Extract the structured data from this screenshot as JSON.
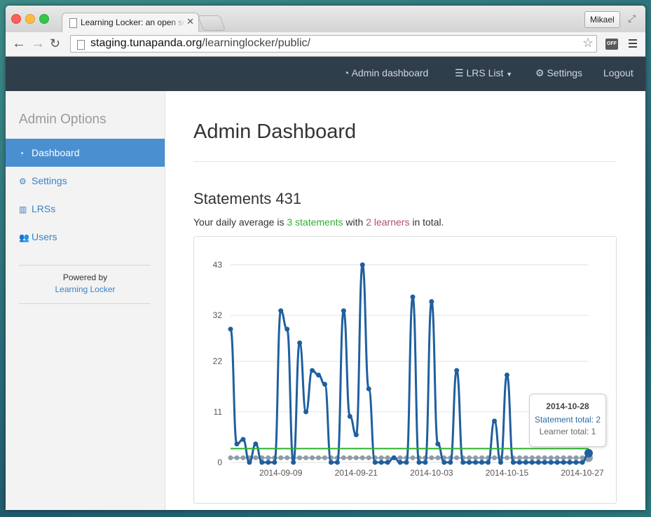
{
  "browser": {
    "tab_title": "Learning Locker: an open source LRS",
    "profile_name": "Mikael",
    "url_host": "staging.tunapanda.org",
    "url_path": "/learninglocker/public/",
    "extension_label": "OFF"
  },
  "navbar": {
    "items": [
      {
        "icon": "dashboard-icon",
        "label": "Admin dashboard"
      },
      {
        "icon": "list-icon",
        "label": "LRS List"
      },
      {
        "icon": "gear-icon",
        "label": "Settings"
      },
      {
        "icon": "",
        "label": "Logout"
      }
    ]
  },
  "sidebar": {
    "heading": "Admin Options",
    "items": [
      {
        "icon": "dashboard-icon",
        "label": "Dashboard",
        "active": true
      },
      {
        "icon": "gear-icon",
        "label": "Settings",
        "active": false
      },
      {
        "icon": "bar-chart-icon",
        "label": "LRSs",
        "active": false
      },
      {
        "icon": "users-icon",
        "label": "Users",
        "active": false
      }
    ],
    "powered_by": "Powered by",
    "powered_link": "Learning Locker"
  },
  "main": {
    "title": "Admin Dashboard",
    "statements_heading": "Statements 431",
    "daily_prefix": "Your daily average is ",
    "daily_statements": "3 statements",
    "daily_mid": " with ",
    "daily_learners": "2 learners",
    "daily_suffix": " in total."
  },
  "tooltip": {
    "date": "2014-10-28",
    "statements": "Statement total: 2",
    "learners": "Learner total: 1"
  },
  "chart_data": {
    "type": "line",
    "y_ticks": [
      0,
      11,
      22,
      32,
      43
    ],
    "ylim": [
      0,
      43
    ],
    "x_tick_labels": [
      "2014-09-09",
      "2014-09-21",
      "2014-10-03",
      "2014-10-15",
      "2014-10-27"
    ],
    "x_start": "2014-09-01",
    "average": 3,
    "grid": true,
    "series": [
      {
        "color": "#1f5f9e",
        "values": [
          29,
          4,
          5,
          0,
          4,
          0,
          0,
          0,
          33,
          29,
          0,
          26,
          11,
          20,
          19,
          17,
          0,
          0,
          33,
          10,
          6,
          43,
          16,
          0,
          0,
          0,
          1,
          0,
          0,
          36,
          0,
          0,
          35,
          4,
          0,
          0,
          20,
          0,
          0,
          0,
          0,
          0,
          9,
          0,
          19,
          0,
          0,
          0,
          0,
          0,
          0,
          0,
          0,
          0,
          0,
          0,
          0,
          2
        ]
      },
      {
        "color": "#8e9ba8",
        "values": [
          1,
          1,
          1,
          1,
          1,
          1,
          1,
          1,
          1,
          1,
          1,
          1,
          1,
          1,
          1,
          1,
          1,
          1,
          1,
          1,
          1,
          1,
          1,
          1,
          1,
          1,
          1,
          1,
          1,
          1,
          1,
          1,
          1,
          1,
          1,
          1,
          1,
          1,
          1,
          1,
          1,
          1,
          1,
          1,
          1,
          1,
          1,
          1,
          1,
          1,
          1,
          1,
          1,
          1,
          1,
          1,
          1,
          1
        ]
      }
    ],
    "average_color": "#2db22d"
  }
}
